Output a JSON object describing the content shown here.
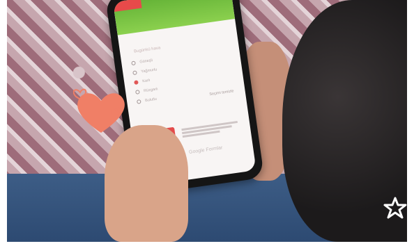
{
  "form": {
    "question": "Bugünkü hava",
    "options": [
      "Güneşli",
      "Yağmurlu",
      "Karlı",
      "Rüzgarlı",
      "Bulutlu"
    ],
    "selected_index": 2,
    "clear_label": "Seçimi temizle",
    "brand": "Google Formlar"
  },
  "colors": {
    "heart": "#f07f66",
    "star": "#ffffff"
  },
  "icons": [
    "heart-sticker-icon",
    "star-logo-icon"
  ]
}
